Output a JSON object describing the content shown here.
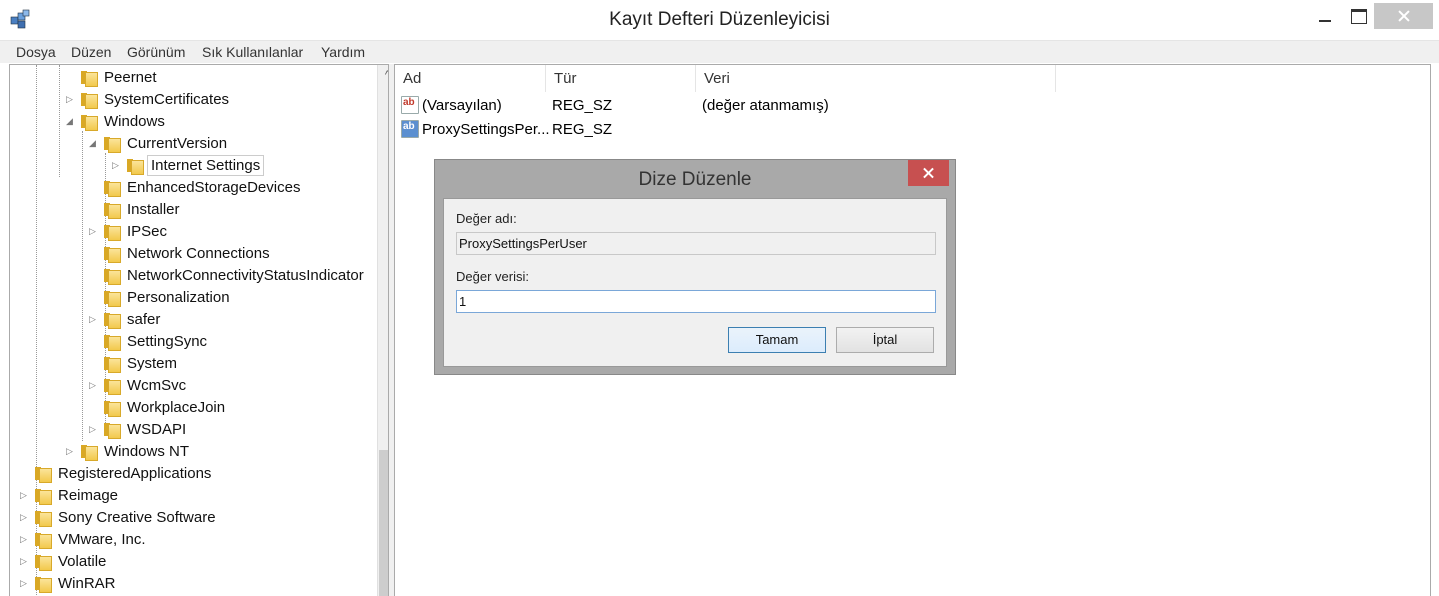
{
  "window": {
    "title": "Kayıt Defteri Düzenleyicisi",
    "icon": "registry-editor-icon"
  },
  "menu": [
    "Dosya",
    "Düzen",
    "Görünüm",
    "Sık Kullanılanlar",
    "Yardım"
  ],
  "tree": {
    "items": [
      {
        "label": "Peernet",
        "expander": ""
      },
      {
        "label": "SystemCertificates",
        "expander": "▷"
      },
      {
        "label": "Windows",
        "expander": "◢"
      },
      {
        "label": "CurrentVersion",
        "expander": "◢"
      },
      {
        "label": "Internet Settings",
        "expander": "▷"
      },
      {
        "label": "EnhancedStorageDevices",
        "expander": ""
      },
      {
        "label": "Installer",
        "expander": ""
      },
      {
        "label": "IPSec",
        "expander": "▷"
      },
      {
        "label": "Network Connections",
        "expander": ""
      },
      {
        "label": "NetworkConnectivityStatusIndicator",
        "expander": ""
      },
      {
        "label": "Personalization",
        "expander": ""
      },
      {
        "label": "safer",
        "expander": "▷"
      },
      {
        "label": "SettingSync",
        "expander": ""
      },
      {
        "label": "System",
        "expander": ""
      },
      {
        "label": "WcmSvc",
        "expander": "▷"
      },
      {
        "label": "WorkplaceJoin",
        "expander": ""
      },
      {
        "label": "WSDAPI",
        "expander": "▷"
      },
      {
        "label": "Windows NT",
        "expander": "▷"
      },
      {
        "label": "RegisteredApplications",
        "expander": ""
      },
      {
        "label": "Reimage",
        "expander": "▷"
      },
      {
        "label": "Sony Creative Software",
        "expander": "▷"
      },
      {
        "label": "VMware, Inc.",
        "expander": "▷"
      },
      {
        "label": "Volatile",
        "expander": "▷"
      },
      {
        "label": "WinRAR",
        "expander": "▷"
      }
    ],
    "scroll_up": "^"
  },
  "list": {
    "columns": [
      "Ad",
      "Tür",
      "Veri"
    ],
    "rows": [
      {
        "icon": "ab",
        "icon_kind": "string-value-icon",
        "name": "(Varsayılan)",
        "type": "REG_SZ",
        "data": "(değer atanmamış)"
      },
      {
        "icon": "ab",
        "icon_kind": "string-value-icon",
        "name": "ProxySettingsPer...",
        "type": "REG_SZ",
        "data": ""
      }
    ]
  },
  "dialog": {
    "title": "Dize Düzenle",
    "name_label": "Değer adı:",
    "name_value": "ProxySettingsPerUser",
    "data_label": "Değer verisi:",
    "data_value": "1",
    "ok_label": "Tamam",
    "cancel_label": "İptal"
  }
}
